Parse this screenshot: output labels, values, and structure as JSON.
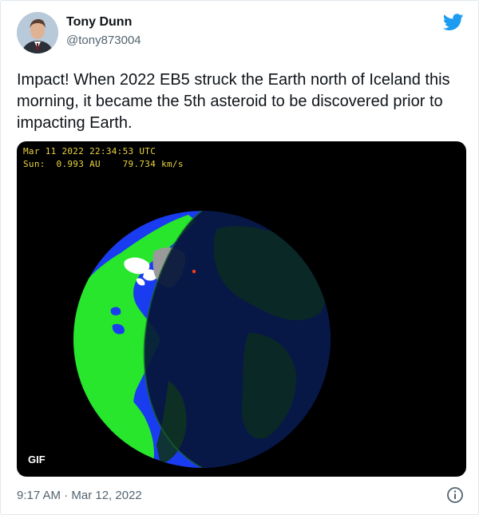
{
  "author": {
    "name": "Tony Dunn",
    "handle": "@tony873004"
  },
  "tweet": {
    "text": "Impact! When 2022 EB5 struck the Earth north of Iceland this morning, it became the 5th asteroid to be discovered prior to impacting Earth."
  },
  "media": {
    "overlay_line1": "Mar 11 2022 22:34:53 UTC",
    "overlay_line2": "Sun:  0.993 AU    79.734 km/s",
    "badge": "GIF",
    "colors": {
      "ocean": "#1a3cf0",
      "land": "#27e62c",
      "night": "#06153a",
      "impact": "#ff3a1a",
      "overlay_text": "#e8d440"
    }
  },
  "footer": {
    "timestamp": "9:17 AM · Mar 12, 2022"
  },
  "icons": {
    "logo": "twitter-bird-icon",
    "info": "info-icon"
  }
}
